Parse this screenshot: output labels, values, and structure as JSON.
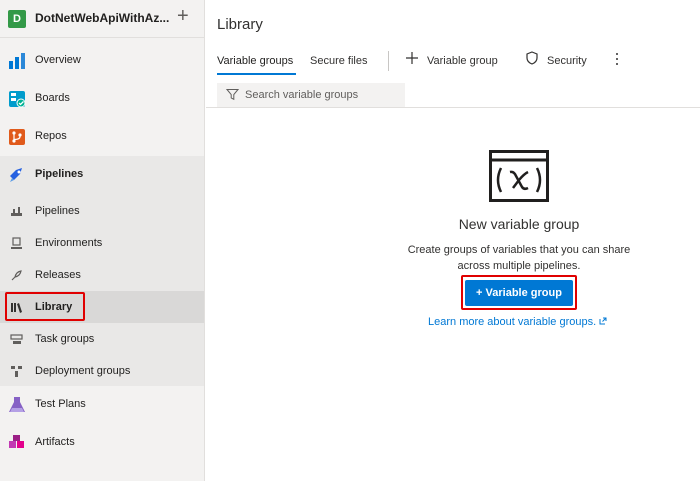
{
  "project": {
    "avatar_letter": "D",
    "name": "DotNetWebApiWithAz..."
  },
  "nav": {
    "overview": "Overview",
    "boards": "Boards",
    "repos": "Repos",
    "pipelines_section": "Pipelines",
    "pipelines_sub": [
      {
        "label": "Pipelines",
        "icon": "pipelines-icon"
      },
      {
        "label": "Environments",
        "icon": "environments-icon"
      },
      {
        "label": "Releases",
        "icon": "releases-icon"
      },
      {
        "label": "Library",
        "icon": "library-icon",
        "selected": true
      },
      {
        "label": "Task groups",
        "icon": "task-groups-icon"
      },
      {
        "label": "Deployment groups",
        "icon": "deployment-groups-icon"
      }
    ],
    "test_plans": "Test Plans",
    "artifacts": "Artifacts"
  },
  "main": {
    "title": "Library",
    "tabs": [
      {
        "label": "Variable groups",
        "active": true
      },
      {
        "label": "Secure files",
        "active": false
      }
    ],
    "commands": {
      "add_variable_group": "Variable group",
      "security": "Security"
    },
    "filter": {
      "placeholder": "Search variable groups"
    },
    "empty_state": {
      "title": "New variable group",
      "description": "Create groups of variables that you can share across multiple pipelines.",
      "button_label": "+ Variable group",
      "link_text": "Learn more about variable groups."
    }
  },
  "colors": {
    "accent": "#0078d4",
    "highlight": "#e00000",
    "project_avatar": "#339947"
  }
}
